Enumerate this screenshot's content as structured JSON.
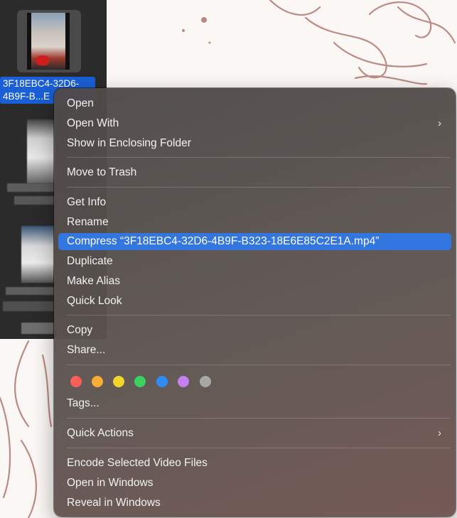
{
  "file": {
    "label_line1": "3F18EBC4-32D6-",
    "label_line2": "4B9F-B...E"
  },
  "menu": {
    "open": "Open",
    "open_with": "Open With",
    "show_in_enclosing_folder": "Show in Enclosing Folder",
    "move_to_trash": "Move to Trash",
    "get_info": "Get Info",
    "rename": "Rename",
    "compress": "Compress “3F18EBC4-32D6-4B9F-B323-18E6E85C2E1A.mp4”",
    "duplicate": "Duplicate",
    "make_alias": "Make Alias",
    "quick_look": "Quick Look",
    "copy": "Copy",
    "share": "Share...",
    "tags": "Tags...",
    "quick_actions": "Quick Actions",
    "encode_selected_video_files": "Encode Selected Video Files",
    "open_in_windows": "Open in Windows",
    "reveal_in_windows": "Reveal in Windows"
  },
  "tag_colors": [
    {
      "name": "red",
      "hex": "#ff5f57"
    },
    {
      "name": "orange",
      "hex": "#fbac34"
    },
    {
      "name": "yellow",
      "hex": "#f5d52a"
    },
    {
      "name": "green",
      "hex": "#3dd15d"
    },
    {
      "name": "blue",
      "hex": "#2f8cf7"
    },
    {
      "name": "purple",
      "hex": "#c67ff0"
    },
    {
      "name": "gray",
      "hex": "#a8a8a8"
    }
  ],
  "highlight_color": "#3476e0",
  "icons": {
    "submenu": "chevron-right-icon"
  }
}
